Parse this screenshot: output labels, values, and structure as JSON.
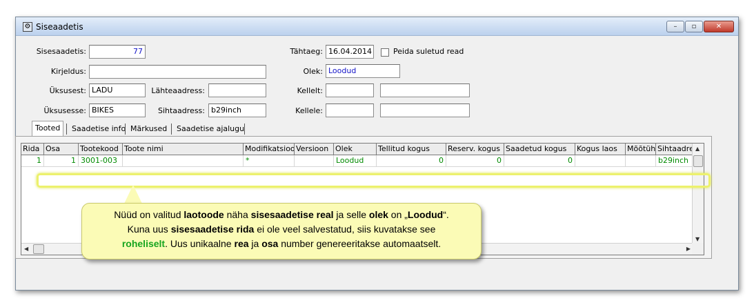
{
  "window": {
    "title": "Siseaadetis",
    "buttons": {
      "minimize": "–",
      "maximize": "▫",
      "close": "✕"
    }
  },
  "form": {
    "sisesaadetis_label": "Sisesaadetis:",
    "sisesaadetis_value": "77",
    "kirjeldus_label": "Kirjeldus:",
    "kirjeldus_value": "",
    "uksusest_label": "Üksusest:",
    "uksusest_value": "LADU",
    "lahteaadress_label": "Lähteaadress:",
    "lahteaadress_value": "",
    "uksusesse_label": "Üksusesse:",
    "uksusesse_value": "BIKES",
    "sihtaadress_label": "Sihtaadress:",
    "sihtaadress_value": "b29inch",
    "tahtaeg_label": "Tähtaeg:",
    "tahtaeg_value": "16.04.2014",
    "peida_label": "Peida suletud read",
    "olek_label": "Olek:",
    "olek_value": "Loodud",
    "kellelt_label": "Kellelt:",
    "kellele_label": "Kellele:"
  },
  "tabs": [
    "Tooted",
    "Saadetise info",
    "Märkused",
    "Saadetise ajalugu"
  ],
  "grid": {
    "headers": [
      "Rida",
      "Osa",
      "Tootekood",
      "Toote nimi",
      "Modifikatsioon",
      "Versioon",
      "Olek",
      "Tellitud kogus",
      "Reserv. kogus",
      "Saadetud kogus",
      "Kogus laos",
      "Mõõtühik",
      "Sihtaadress"
    ],
    "row": [
      "1",
      "1",
      "3001-003",
      "",
      "*",
      "",
      "Loodud",
      "0",
      "0",
      "0",
      "",
      "",
      "b29inch"
    ]
  },
  "callout": {
    "l1a": "Nüüd on valitud ",
    "l1b": "laotoode",
    "l1c": " näha ",
    "l1d": "sisesaadetise real",
    "l1e": " ja selle ",
    "l1f": "olek",
    "l1g": " on „",
    "l1h": "Loodud",
    "l1i": "“.",
    "l2a": "Kuna uus ",
    "l2b": "sisesaadetise rida",
    "l2c": " ei ole veel salvestatud, siis kuvatakse see",
    "l3a": "roheliselt",
    "l3b": ".  Uus unikaalne ",
    "l3c": "rea",
    "l3d": " ja ",
    "l3e": "osa",
    "l3f": " number genereeritakse automaatselt."
  },
  "colors": {
    "new_row_text": "#008a00",
    "highlight": "#ecf16c",
    "callout_bg": "#fbfbb6"
  }
}
